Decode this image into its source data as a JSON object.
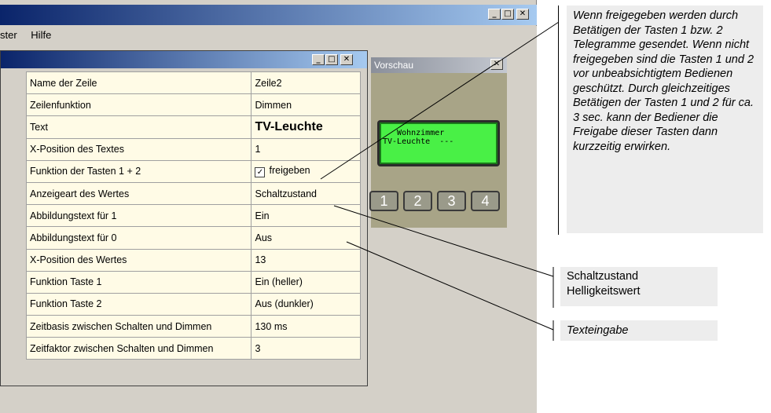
{
  "app": {
    "menu": [
      "ster",
      "Hilfe"
    ]
  },
  "properties": {
    "rows": [
      {
        "name": "Name der Zeile",
        "value": "Zeile2"
      },
      {
        "name": "Zeilenfunktion",
        "value": "Dimmen"
      },
      {
        "name": "Text",
        "value": "TV-Leuchte"
      },
      {
        "name": "X-Position des Textes",
        "value": "1"
      },
      {
        "name": "Funktion der Tasten 1 + 2",
        "value": "freigeben"
      },
      {
        "name": "Anzeigeart des Wertes",
        "value": "Schaltzustand"
      },
      {
        "name": "Abbildungstext für 1",
        "value": "Ein"
      },
      {
        "name": "Abbildungstext für 0",
        "value": "Aus"
      },
      {
        "name": "X-Position des Wertes",
        "value": "13"
      },
      {
        "name": "Funktion Taste 1",
        "value": "Ein (heller)"
      },
      {
        "name": "Funktion Taste 2",
        "value": "Aus (dunkler)"
      },
      {
        "name": "Zeitbasis zwischen Schalten und Dimmen",
        "value": "130 ms"
      },
      {
        "name": "Zeitfaktor zwischen Schalten und Dimmen",
        "value": "3"
      }
    ]
  },
  "preview": {
    "title": "Vorschau",
    "lcd_line1": "   Wohnzimmer",
    "lcd_line2": "TV-Leuchte  ---",
    "keys": [
      "1",
      "2",
      "3",
      "4"
    ]
  },
  "callouts": {
    "main": "Wenn freigegeben werden durch Betätigen der Tasten 1 bzw. 2 Telegramme gesendet. Wenn nicht freigegeben sind die Tasten 1 und 2 vor unbeabsichtigtem Bedienen geschützt. Durch gleichzeitiges Betätigen der Tasten 1 und 2 für ca. 3 sec. kann der Bediener die Freigabe dieser Tasten dann kurzzeitig erwirken.",
    "state_line1": "Schaltzustand",
    "state_line2": "Helligkeitswert",
    "text": "Texteingabe"
  },
  "icons": {
    "minimize": "minimize-icon",
    "maximize": "maximize-icon",
    "close": "close-icon",
    "checkbox": "checkbox-checked-icon",
    "scroll_up": "scroll-up-icon",
    "scroll_down": "scroll-down-icon"
  }
}
